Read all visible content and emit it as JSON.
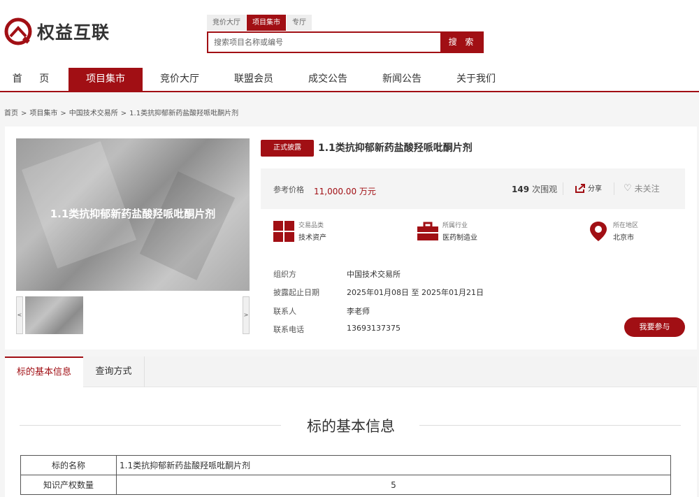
{
  "brand": {
    "name": "权益互联",
    "accent_color": "#a10f14"
  },
  "search": {
    "tabs": [
      "竞价大厅",
      "项目集市",
      "专厅"
    ],
    "active_tab": "项目集市",
    "placeholder": "搜索项目名称或编号",
    "button_label": "搜 索"
  },
  "nav": {
    "items": [
      "首 页",
      "项目集市",
      "竞价大厅",
      "联盟会员",
      "成交公告",
      "新闻公告",
      "关于我们"
    ],
    "active": "项目集市"
  },
  "breadcrumb": [
    "首页",
    "项目集市",
    "中国技术交易所",
    "1.1类抗抑郁新药盐酸羟哌吡酮片剂"
  ],
  "item": {
    "status": "正式披露",
    "title": "1.1类抗抑郁新药盐酸羟哌吡酮片剂",
    "image_caption": "1.1类抗抑郁新药盐酸羟哌吡酮片剂",
    "prev_label": "<",
    "next_label": ">",
    "price_label": "参考价格",
    "price_value": "11,000.00 万元",
    "views_count": "149",
    "views_label": "次围观",
    "share_label": "分享",
    "follow_label": "未关注",
    "features": [
      {
        "icon": "grid-category-icon",
        "key": "交易品类",
        "value": "技术资产"
      },
      {
        "icon": "briefcase-icon",
        "key": "所属行业",
        "value": "医药制造业"
      },
      {
        "icon": "map-pin-icon",
        "key": "所在地区",
        "value": "北京市"
      }
    ],
    "info": [
      {
        "key": "组织方",
        "value": "中国技术交易所"
      },
      {
        "key": "披露起止日期",
        "value": "2025年01月08日 至 2025年01月21日"
      },
      {
        "key": "联系人",
        "value": "李老师"
      },
      {
        "key": "联系电话",
        "value": "13693137375"
      }
    ],
    "join_button": "我要参与"
  },
  "tabs": {
    "basic": "标的基本信息",
    "contact": "查询方式"
  },
  "basic_info": {
    "title": "标的基本信息",
    "rows": [
      {
        "key": "标的名称",
        "value": "1.1类抗抑郁新药盐酸羟哌吡酮片剂"
      },
      {
        "key": "知识产权数量",
        "value": "5"
      }
    ]
  }
}
